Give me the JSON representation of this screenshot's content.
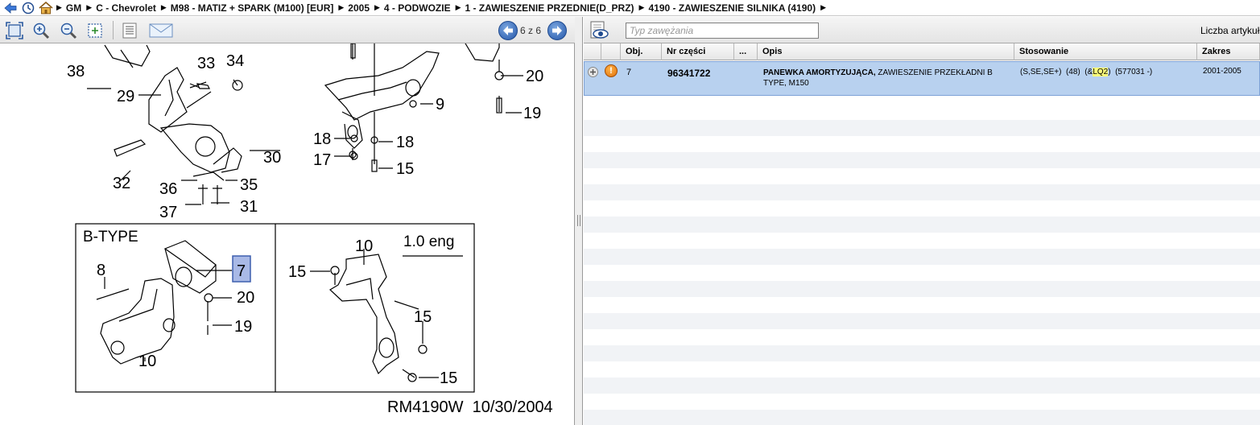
{
  "breadcrumb": {
    "items": [
      "GM",
      "C - Chevrolet",
      "M98 - MATIZ + SPARK (M100) [EUR]",
      "2005",
      "4 - PODWOZIE",
      "1 - ZAWIESZENIE PRZEDNIE(D_PRZ)",
      "4190 - ZAWIESZENIE SILNIKA  (4190)"
    ]
  },
  "viewer": {
    "pager": "6 z 6"
  },
  "diagram": {
    "callouts": [
      "38",
      "33",
      "34",
      "29",
      "30",
      "32",
      "36",
      "35",
      "37",
      "31",
      "20",
      "19",
      "9",
      "18",
      "18",
      "17",
      "15"
    ],
    "btype_label": "B-TYPE",
    "btype_callouts": [
      "8",
      "7",
      "20",
      "19",
      "10"
    ],
    "eng_label": "1.0 eng",
    "eng_callouts": [
      "10",
      "15",
      "15",
      "15"
    ],
    "drawing_ref": "RM4190W  10/30/2004"
  },
  "parts": {
    "filter_placeholder": "Typ zawężania",
    "count_label": "Liczba artykułów",
    "columns": [
      "Obj.",
      "Nr części",
      "...",
      "Opis",
      "Stosowanie",
      "Zakres"
    ],
    "rows": [
      {
        "obj": "7",
        "part_no": "96341722",
        "desc_bold": "PANEWKA AMORTYZUJĄCA,",
        "desc_rest": "ZAWIESZENIE PRZEKŁADNI B",
        "desc_line2": "TYPE, M150",
        "usage_pre": "(S,SE,SE+)  (48)  (&",
        "usage_hl": "LQ2",
        "usage_post": ")  (577031 -)",
        "range": "2001-2005"
      }
    ]
  },
  "colors": {
    "selected_row": "#b8d1ef",
    "highlight": "#ffff7a",
    "callout_box": "#a9b9e6"
  }
}
